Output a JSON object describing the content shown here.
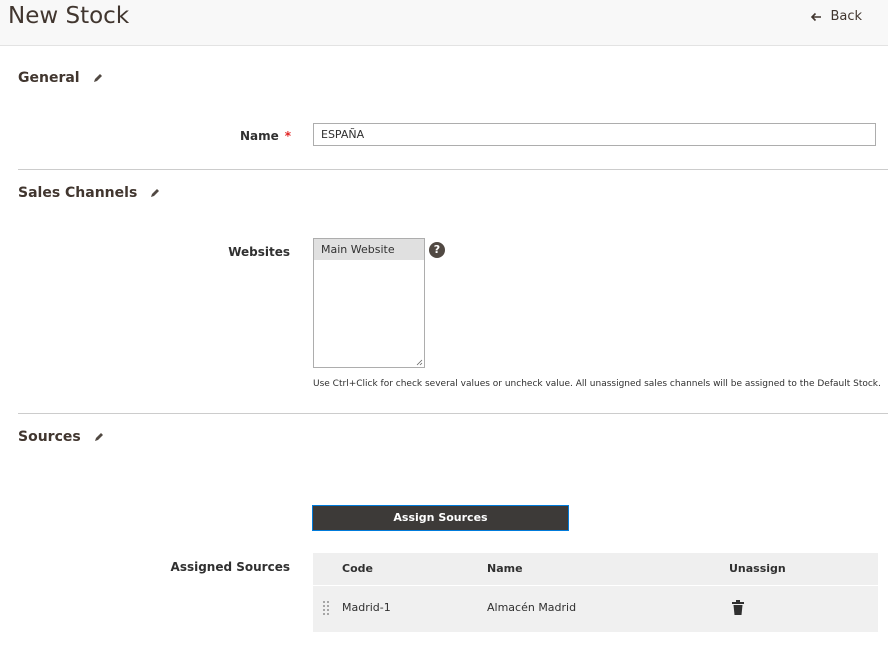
{
  "header": {
    "title": "New Stock",
    "back_label": "Back"
  },
  "general": {
    "section_title": "General",
    "name_label": "Name",
    "name_required_marker": "*",
    "name_value": "ESPAÑA"
  },
  "sales_channels": {
    "section_title": "Sales Channels",
    "websites_label": "Websites",
    "websites_options": [
      "Main Website"
    ],
    "help_glyph": "?",
    "note": "Use Ctrl+Click for check several values or uncheck value. All unassigned sales channels will be assigned to the Default Stock."
  },
  "sources": {
    "section_title": "Sources",
    "assign_button": "Assign Sources",
    "assigned_label": "Assigned Sources",
    "columns": {
      "code": "Code",
      "name": "Name",
      "unassign": "Unassign"
    },
    "rows": [
      {
        "code": "Madrid-1",
        "name": "Almacén Madrid"
      }
    ]
  },
  "icons": {
    "back": "arrow-left-icon",
    "edit": "pencil-icon",
    "help": "question-circle-icon",
    "drag": "drag-handle-icon",
    "delete": "trash-icon"
  },
  "colors": {
    "header_bg": "#f8f8f8",
    "button_bg": "#3d3a38",
    "button_border": "#007bdb",
    "required": "#e22626",
    "selected_option": "#e0e0e0"
  }
}
